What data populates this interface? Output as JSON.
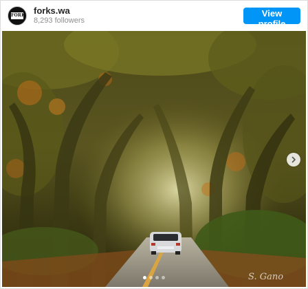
{
  "header": {
    "username": "forks.wa",
    "followers": "8,293 followers",
    "view_profile_label": "View profile",
    "avatar_text": "FORKS"
  },
  "colors": {
    "button": "#0095f6",
    "username": "#262626",
    "secondary_text": "#8e8e8e"
  },
  "photo": {
    "signature_text": "S. Gano"
  },
  "carousel": {
    "next_icon": "chevron-right-icon",
    "slide_count": 4,
    "active_index": 0
  }
}
